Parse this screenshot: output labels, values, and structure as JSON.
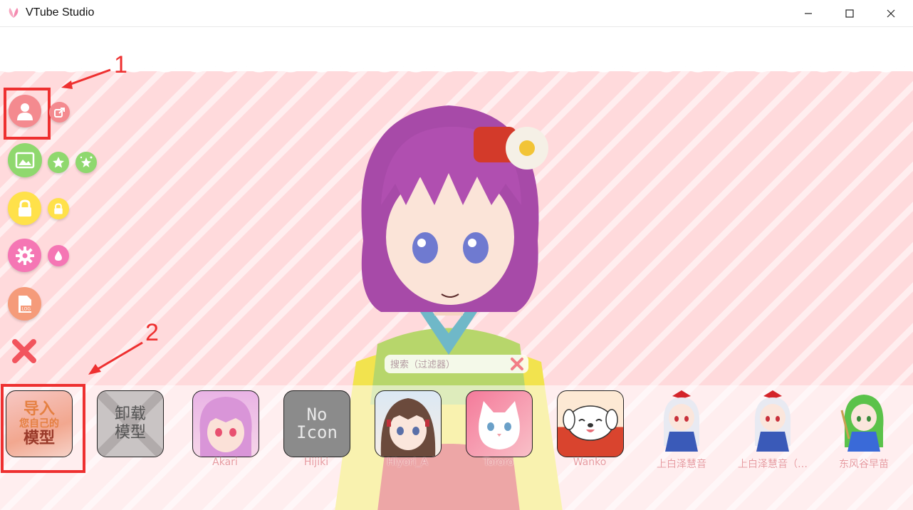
{
  "window": {
    "title": "VTube Studio"
  },
  "annotations": {
    "marker_1": "1",
    "marker_2": "2"
  },
  "search": {
    "placeholder": "搜索（过滤器）"
  },
  "import_tile": {
    "line1": "导入",
    "line2": "您自己的",
    "line3": "模型"
  },
  "unload_tile": {
    "line1": "卸载",
    "line2": "模型"
  },
  "no_icon_text": {
    "line1": "No",
    "line2": "Icon"
  },
  "models": [
    {
      "label": "Akari"
    },
    {
      "label": "Hijiki"
    },
    {
      "label": "Hiyori_A"
    },
    {
      "label": "Tororo"
    },
    {
      "label": "Wanko"
    },
    {
      "label": "上白泽慧音"
    },
    {
      "label": "上白泽慧音（…"
    },
    {
      "label": "东风谷早苗"
    }
  ],
  "icons": {
    "model-select": "person-icon",
    "model-share": "share-icon",
    "background": "image-icon",
    "favorite": "star-icon",
    "favorite-sparkle": "sparkle-star-icon",
    "lock": "lock-icon",
    "lock-small": "lock-icon",
    "settings": "gear-icon",
    "drop": "drop-icon",
    "log": "log-icon",
    "close": "x-icon"
  },
  "colors": {
    "annotation_red": "#ee3030",
    "background_pink": "#ffdadc",
    "person_button": "#f48a8f",
    "image_button": "#8fd86e",
    "lock_button": "#ffe14a",
    "gear_button": "#f576b4",
    "log_button": "#f59b7a",
    "close_x": "#f2545d",
    "label_pink": "#e79aa0"
  }
}
